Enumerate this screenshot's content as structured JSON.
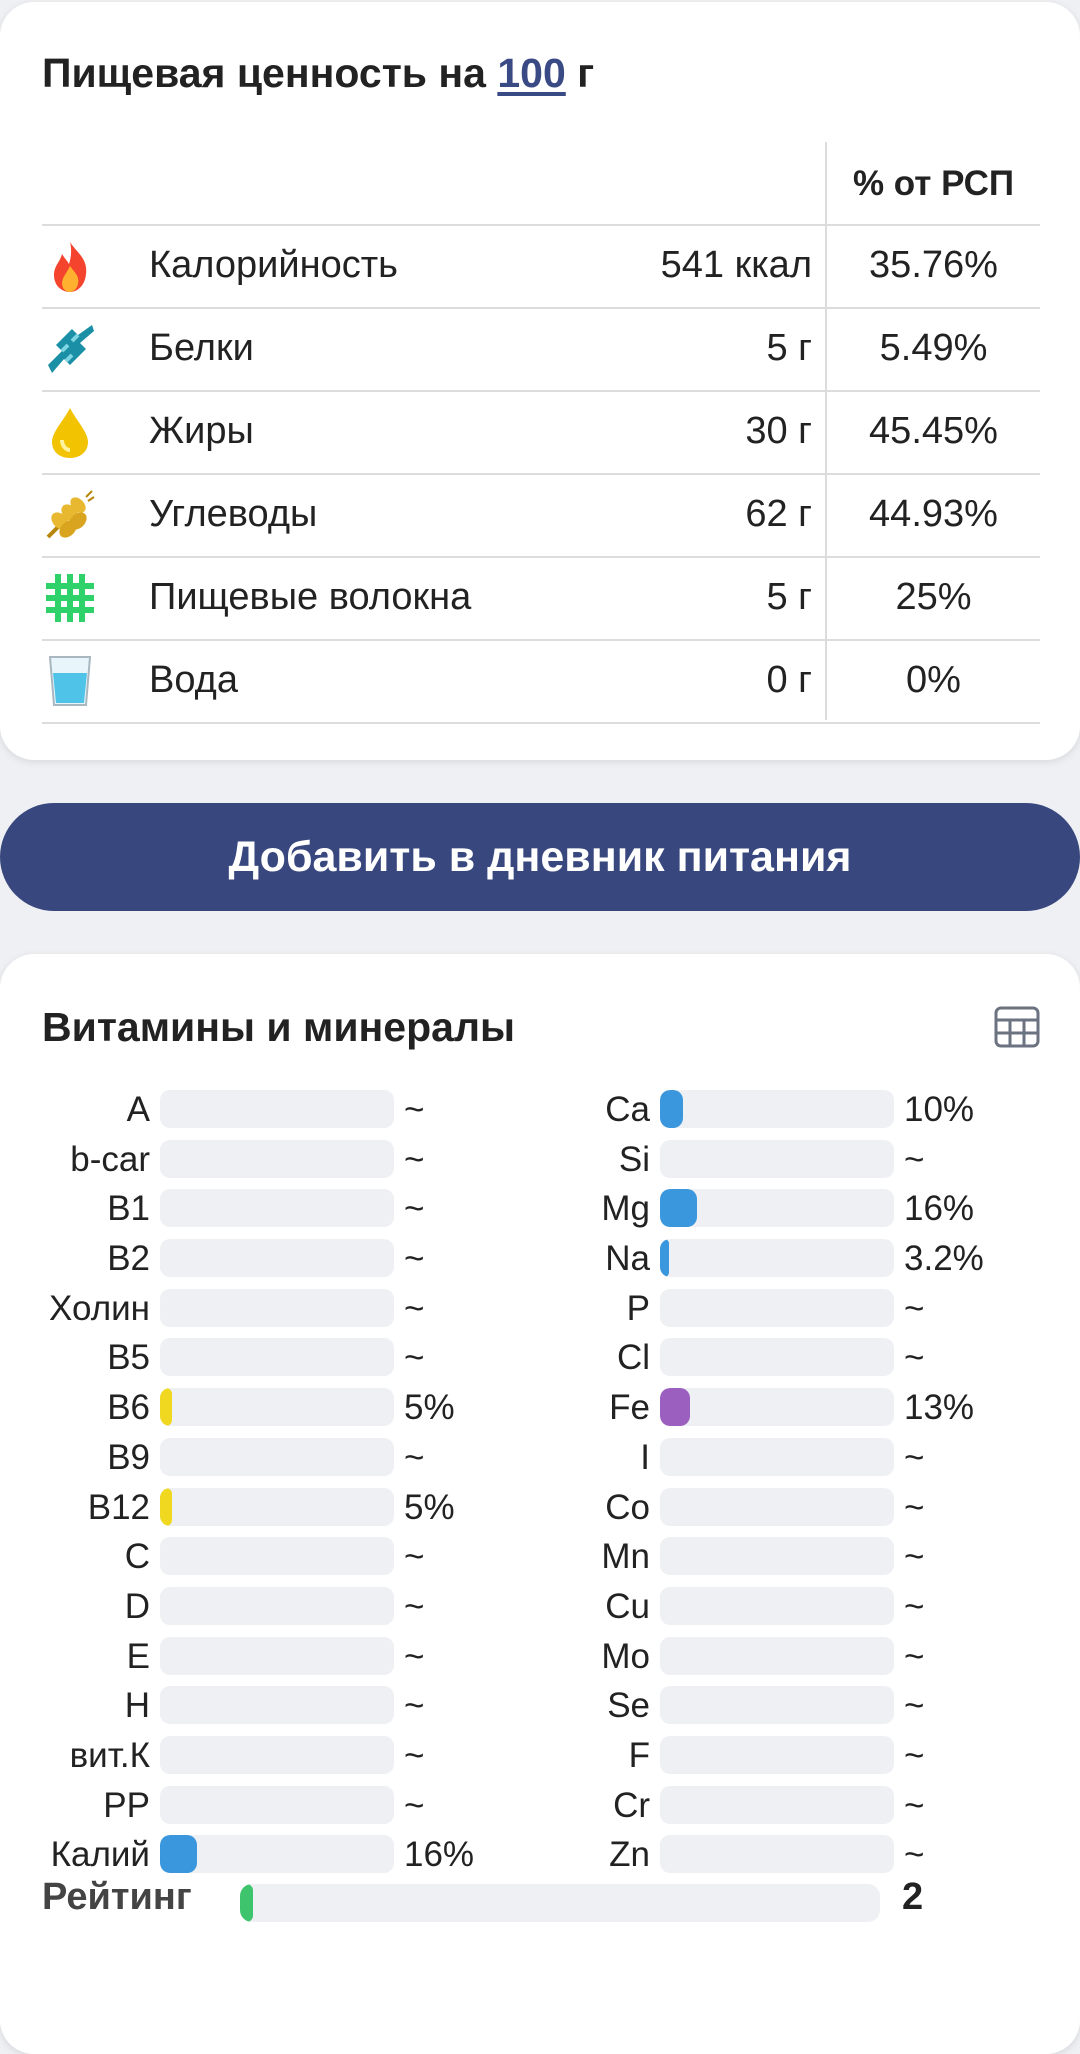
{
  "nutrition": {
    "title_prefix": "Пищевая ценность на",
    "title_amount": "100",
    "title_suffix": "г",
    "pct_header": "% от РСП",
    "rows": [
      {
        "icon": "fire-icon",
        "label": "Калорийность",
        "amount": "541 ккал",
        "pct": "35.76%"
      },
      {
        "icon": "protein-icon",
        "label": "Белки",
        "amount": "5 г",
        "pct": "5.49%"
      },
      {
        "icon": "oil-drop-icon",
        "label": "Жиры",
        "amount": "30 г",
        "pct": "45.45%"
      },
      {
        "icon": "wheat-icon",
        "label": "Углеводы",
        "amount": "62 г",
        "pct": "44.93%"
      },
      {
        "icon": "fiber-grid-icon",
        "label": "Пищевые волокна",
        "amount": "5 г",
        "pct": "25%"
      },
      {
        "icon": "water-glass-icon",
        "label": "Вода",
        "amount": "0 г",
        "pct": "0%"
      }
    ]
  },
  "add_button_label": "Добавить в дневник питания",
  "vitamins": {
    "title": "Витамины и минералы",
    "table_icon": "table-grid-icon",
    "colors": {
      "blue": "#3a97dd",
      "yellow": "#f0d820",
      "purple": "#9b5fc0",
      "green": "#3ec46d",
      "track": "#eef0f3"
    },
    "left": [
      {
        "name": "A",
        "value": "~",
        "level": 0,
        "color": ""
      },
      {
        "name": "b-car",
        "value": "~",
        "level": 0,
        "color": ""
      },
      {
        "name": "B1",
        "value": "~",
        "level": 0,
        "color": ""
      },
      {
        "name": "B2",
        "value": "~",
        "level": 0,
        "color": ""
      },
      {
        "name": "Холин",
        "value": "~",
        "level": 0,
        "color": ""
      },
      {
        "name": "B5",
        "value": "~",
        "level": 0,
        "color": ""
      },
      {
        "name": "B6",
        "value": "5%",
        "level": 5,
        "color": "#f0d820"
      },
      {
        "name": "B9",
        "value": "~",
        "level": 0,
        "color": ""
      },
      {
        "name": "B12",
        "value": "5%",
        "level": 5,
        "color": "#f0d820"
      },
      {
        "name": "C",
        "value": "~",
        "level": 0,
        "color": ""
      },
      {
        "name": "D",
        "value": "~",
        "level": 0,
        "color": ""
      },
      {
        "name": "E",
        "value": "~",
        "level": 0,
        "color": ""
      },
      {
        "name": "H",
        "value": "~",
        "level": 0,
        "color": ""
      },
      {
        "name": "вит.К",
        "value": "~",
        "level": 0,
        "color": ""
      },
      {
        "name": "PP",
        "value": "~",
        "level": 0,
        "color": ""
      },
      {
        "name": "Калий",
        "value": "16%",
        "level": 16,
        "color": "#3a97dd"
      }
    ],
    "right": [
      {
        "name": "Ca",
        "value": "10%",
        "level": 10,
        "color": "#3a97dd"
      },
      {
        "name": "Si",
        "value": "~",
        "level": 0,
        "color": ""
      },
      {
        "name": "Mg",
        "value": "16%",
        "level": 16,
        "color": "#3a97dd"
      },
      {
        "name": "Na",
        "value": "3.2%",
        "level": 3.2,
        "color": "#3a97dd"
      },
      {
        "name": "P",
        "value": "~",
        "level": 0,
        "color": ""
      },
      {
        "name": "Cl",
        "value": "~",
        "level": 0,
        "color": ""
      },
      {
        "name": "Fe",
        "value": "13%",
        "level": 13,
        "color": "#9b5fc0"
      },
      {
        "name": "I",
        "value": "~",
        "level": 0,
        "color": ""
      },
      {
        "name": "Co",
        "value": "~",
        "level": 0,
        "color": ""
      },
      {
        "name": "Mn",
        "value": "~",
        "level": 0,
        "color": ""
      },
      {
        "name": "Cu",
        "value": "~",
        "level": 0,
        "color": ""
      },
      {
        "name": "Mo",
        "value": "~",
        "level": 0,
        "color": ""
      },
      {
        "name": "Se",
        "value": "~",
        "level": 0,
        "color": ""
      },
      {
        "name": "F",
        "value": "~",
        "level": 0,
        "color": ""
      },
      {
        "name": "Cr",
        "value": "~",
        "level": 0,
        "color": ""
      },
      {
        "name": "Zn",
        "value": "~",
        "level": 0,
        "color": ""
      }
    ]
  },
  "rating": {
    "label": "Рейтинг",
    "value": "2",
    "level": 2,
    "color": "#3ec46d"
  }
}
